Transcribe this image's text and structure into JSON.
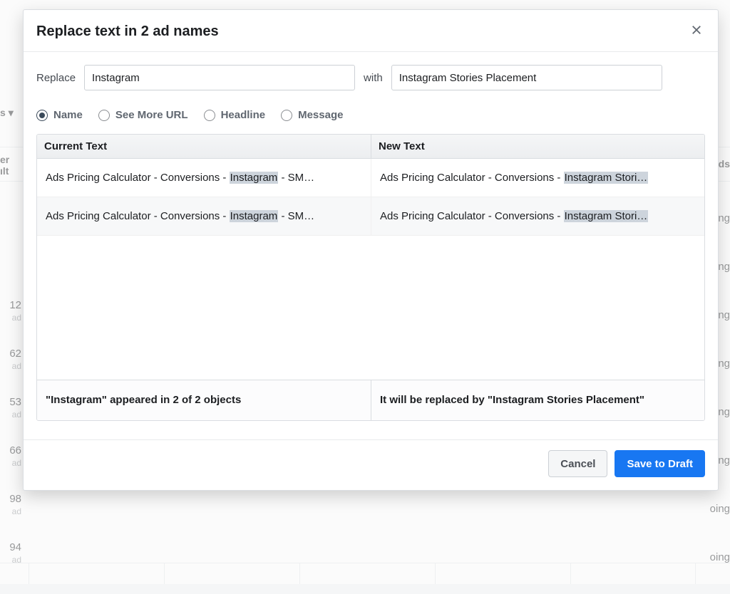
{
  "modal": {
    "title": "Replace text in 2 ad names",
    "replace_label": "Replace",
    "with_label": "with",
    "find_value": "Instagram",
    "replace_value": "Instagram Stories Placement",
    "radios": {
      "name": "Name",
      "see_more_url": "See More URL",
      "headline": "Headline",
      "message": "Message"
    },
    "table": {
      "col_current": "Current Text",
      "col_new": "New Text",
      "rows": [
        {
          "current_prefix": "Ads Pricing Calculator - Conversions - ",
          "current_match": "Instagram",
          "current_suffix": " - SM…",
          "new_prefix": "Ads Pricing Calculator - Conversions - ",
          "new_match": "Instagram Stori…",
          "new_suffix": ""
        },
        {
          "current_prefix": "Ads Pricing Calculator - Conversions - ",
          "current_match": "Instagram",
          "current_suffix": " - SM…",
          "new_prefix": "Ads Pricing Calculator - Conversions - ",
          "new_match": "Instagram Stori…",
          "new_suffix": ""
        }
      ],
      "foot_left": "\"Instagram\" appeared in 2 of 2 objects",
      "foot_right": "It will be replaced by \"Instagram Stories Placement\""
    },
    "buttons": {
      "cancel": "Cancel",
      "save": "Save to Draft"
    }
  },
  "background": {
    "dropdown_label": "s",
    "header_left": "er",
    "header_left2": "ılt",
    "header_right": "nds",
    "right_values": [
      "oing",
      "oing",
      "oing",
      "oing",
      "oing",
      "oing",
      "oing",
      "oing"
    ],
    "left_cells": [
      {
        "num": "12",
        "sub": "ad"
      },
      {
        "num": "62",
        "sub": "ad"
      },
      {
        "num": "53",
        "sub": "ad"
      },
      {
        "num": "66",
        "sub": "ad"
      },
      {
        "num": "98",
        "sub": "ad"
      },
      {
        "num": "94",
        "sub": "ad"
      }
    ]
  }
}
